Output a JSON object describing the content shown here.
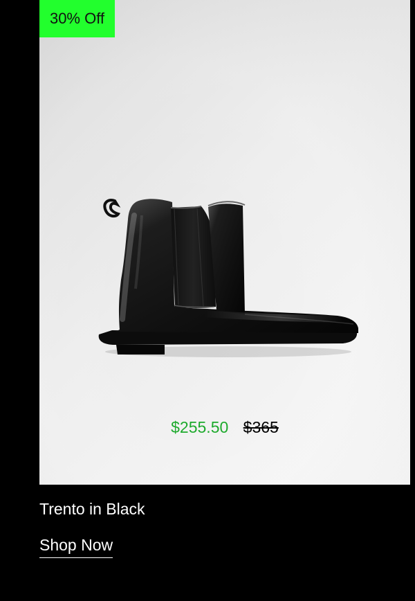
{
  "product": {
    "badge": "30% Off",
    "image_alt": "Trento in Black",
    "sale_price": "$255.50",
    "original_price": "$365",
    "title": "Trento in Black",
    "cta": "Shop Now"
  },
  "colors": {
    "badge_bg": "#22ff2d",
    "sale_price": "#1eaa2d",
    "page_bg": "#000000"
  }
}
